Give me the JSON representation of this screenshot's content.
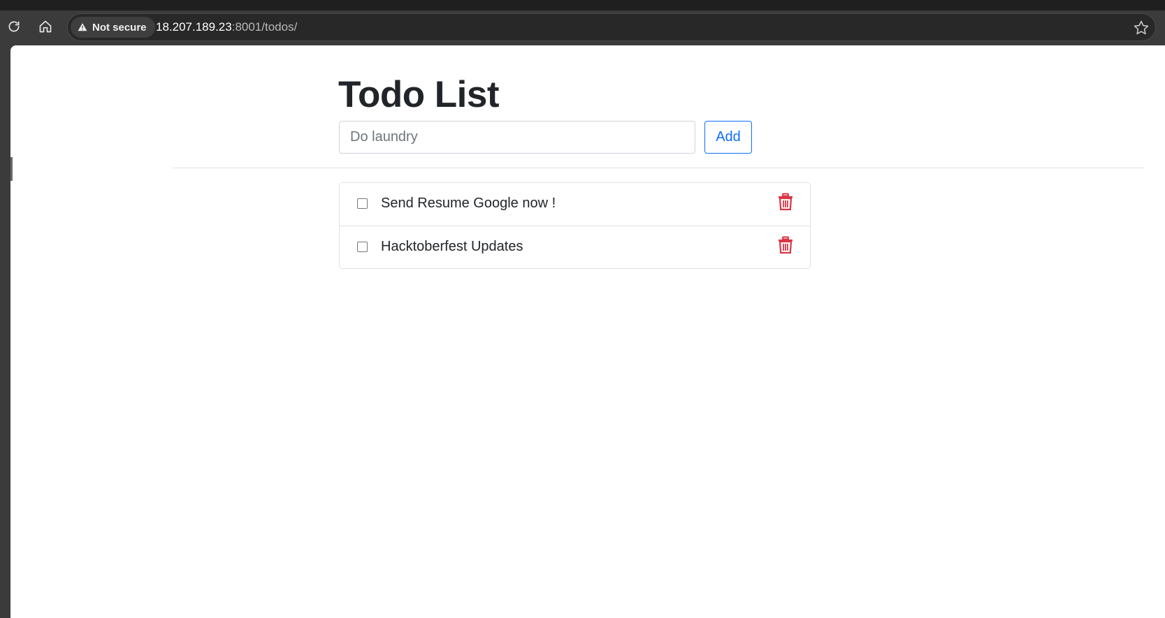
{
  "browser": {
    "security_label": "Not secure",
    "url_host": "18.207.189.23",
    "url_path": ":8001/todos/"
  },
  "app": {
    "title": "Todo List",
    "input": {
      "placeholder": "Do laundry",
      "value": ""
    },
    "add_label": "Add"
  },
  "todos": [
    {
      "text": "Send Resume Google now !",
      "done": false
    },
    {
      "text": "Hacktoberfest Updates",
      "done": false
    }
  ],
  "icons": {
    "reload": "reload-icon",
    "home": "home-icon",
    "warning": "warning-icon",
    "star": "star-icon",
    "delete": "trash-icon"
  },
  "colors": {
    "primary": "#0d6efd",
    "danger": "#dc3545",
    "text": "#212529",
    "border": "#dee2e6"
  }
}
